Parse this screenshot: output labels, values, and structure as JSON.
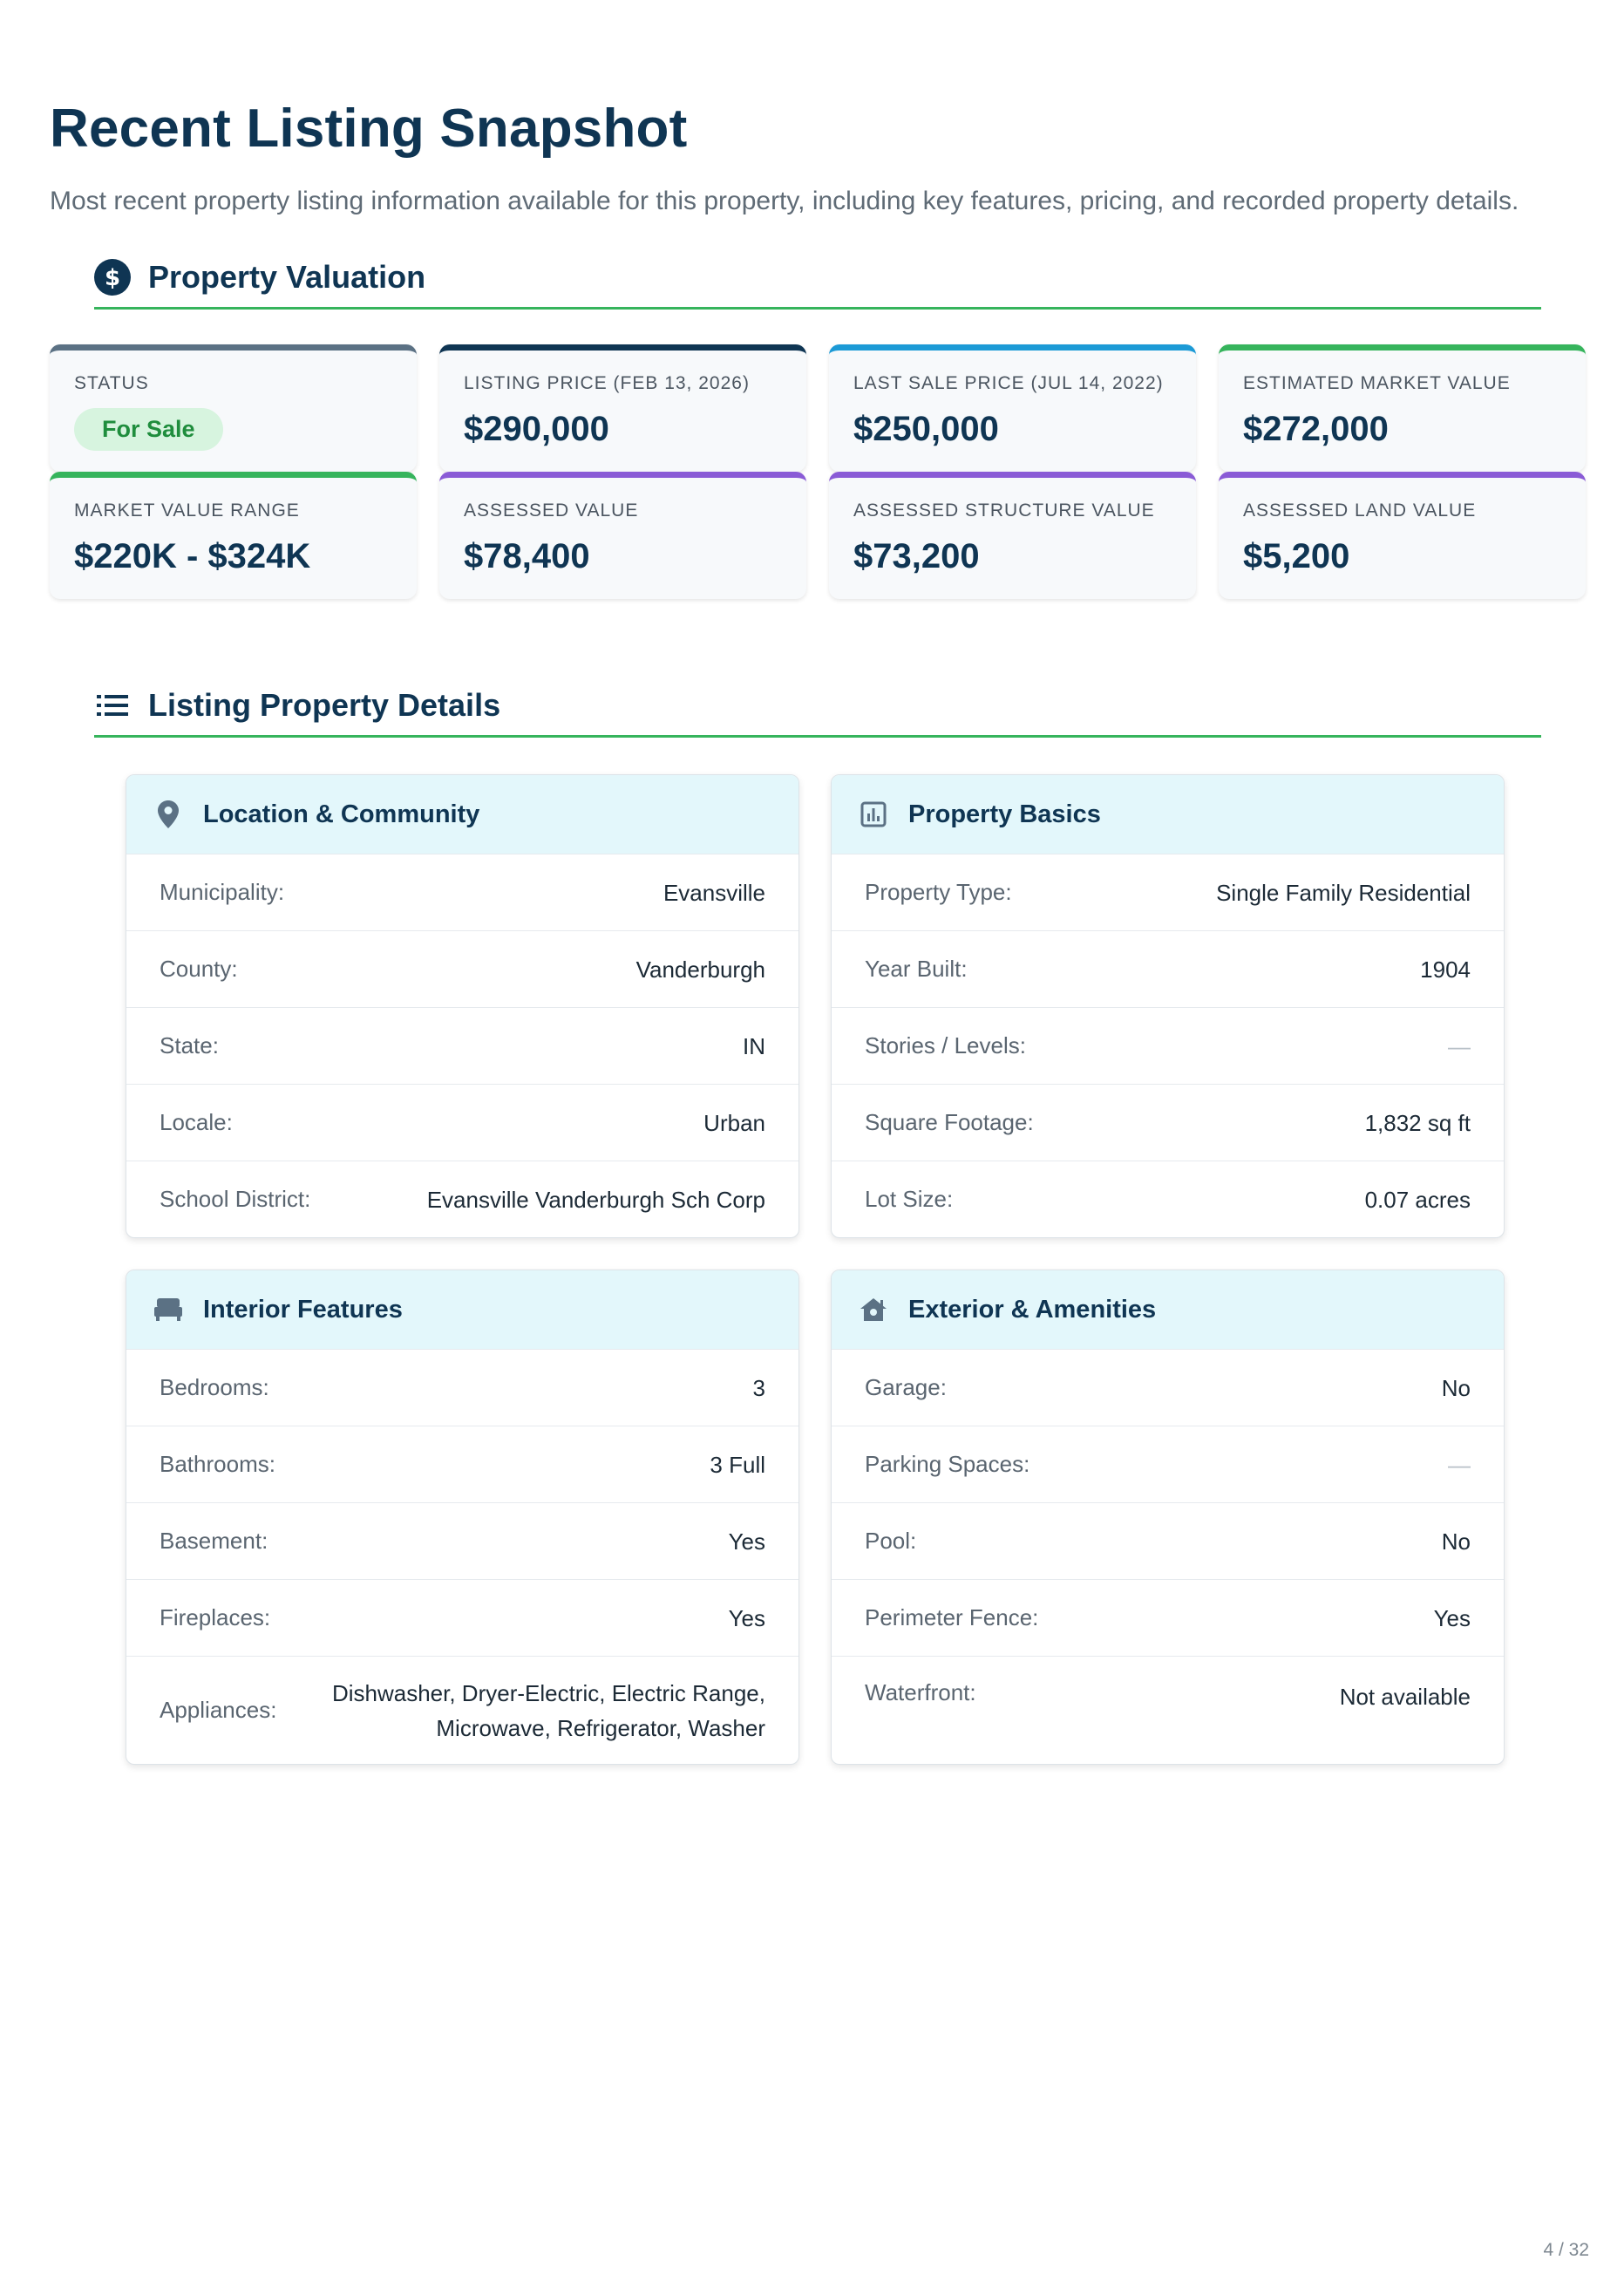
{
  "page": {
    "title": "Recent Listing Snapshot",
    "subtitle": "Most recent property listing information available for this property, including key features, pricing, and recorded property details.",
    "page_number": "4 / 32"
  },
  "valuation": {
    "section_title": "Property Valuation",
    "icon": "dollar-circle-icon",
    "status": {
      "label": "STATUS",
      "value": "For Sale",
      "accent": "#5b7184"
    },
    "cards": [
      {
        "label": "LISTING PRICE (FEB 13, 2026)",
        "value": "$290,000",
        "accent": "#0f3553"
      },
      {
        "label": "LAST SALE PRICE (JUL 14, 2022)",
        "value": "$250,000",
        "accent": "#1c9ad6"
      },
      {
        "label": "ESTIMATED MARKET VALUE",
        "value": "$272,000",
        "accent": "#36b45c"
      },
      {
        "label": "MARKET VALUE RANGE",
        "value": "$220K - $324K",
        "accent": "#36b45c"
      },
      {
        "label": "ASSESSED VALUE",
        "value": "$78,400",
        "accent": "#8a5bd6"
      },
      {
        "label": "ASSESSED STRUCTURE VALUE",
        "value": "$73,200",
        "accent": "#8a5bd6"
      },
      {
        "label": "ASSESSED LAND VALUE",
        "value": "$5,200",
        "accent": "#8a5bd6"
      }
    ]
  },
  "details": {
    "section_title": "Listing Property Details",
    "icon": "list-icon",
    "location": {
      "title": "Location & Community",
      "icon": "map-pin-icon",
      "rows": [
        {
          "label": "Municipality:",
          "value": "Evansville"
        },
        {
          "label": "County:",
          "value": "Vanderburgh"
        },
        {
          "label": "State:",
          "value": "IN"
        },
        {
          "label": "Locale:",
          "value": "Urban"
        },
        {
          "label": "School District:",
          "value": "Evansville Vanderburgh Sch Corp"
        }
      ]
    },
    "basics": {
      "title": "Property Basics",
      "icon": "bar-chart-icon",
      "rows": [
        {
          "label": "Property Type:",
          "value": "Single Family Residential"
        },
        {
          "label": "Year Built:",
          "value": "1904"
        },
        {
          "label": "Stories / Levels:",
          "value": "—"
        },
        {
          "label": "Square Footage:",
          "value": "1,832 sq ft"
        },
        {
          "label": "Lot Size:",
          "value": "0.07 acres"
        }
      ]
    },
    "interior": {
      "title": "Interior Features",
      "icon": "bed-icon",
      "rows": [
        {
          "label": "Bedrooms:",
          "value": "3"
        },
        {
          "label": "Bathrooms:",
          "value": "3 Full"
        },
        {
          "label": "Basement:",
          "value": "Yes"
        },
        {
          "label": "Fireplaces:",
          "value": "Yes"
        },
        {
          "label": "Appliances:",
          "value_line1": "Dishwasher, Dryer-Electric, Electric Range,",
          "value_line2": "Microwave, Refrigerator, Washer"
        }
      ]
    },
    "exterior": {
      "title": "Exterior & Amenities",
      "icon": "house-icon",
      "rows": [
        {
          "label": "Garage:",
          "value": "No"
        },
        {
          "label": "Parking Spaces:",
          "value": "—"
        },
        {
          "label": "Pool:",
          "value": "No"
        },
        {
          "label": "Perimeter Fence:",
          "value": "Yes"
        },
        {
          "label": "Waterfront:",
          "value": "Not available"
        }
      ]
    }
  }
}
